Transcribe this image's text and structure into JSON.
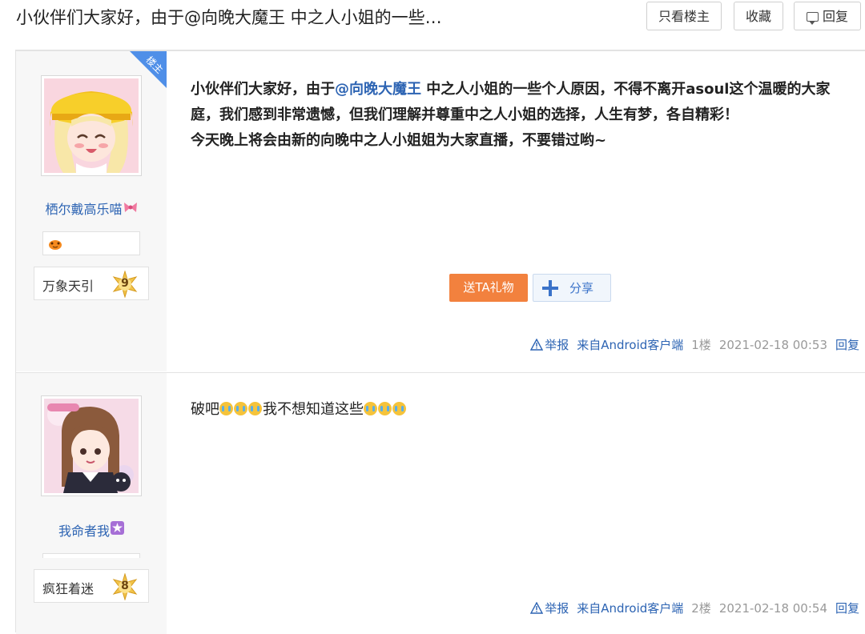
{
  "header": {
    "title": "小伙伴们大家好，由于@向晚大魔王 中之人小姐的一些…",
    "only_op_label": "只看楼主",
    "favorite_label": "收藏",
    "reply_label": "回复"
  },
  "posts": [
    {
      "is_op": true,
      "op_badge": "楼主",
      "username": "栖尔戴高乐喵",
      "level_name": "万象天引",
      "level": "9",
      "content_before": "小伙伴们大家好，由于",
      "mention": "@向晚大魔王",
      "content_after": " 中之人小姐的一些个人原因，不得不离开asoul这个温暖的大家庭，我们感到非常遗憾，但我们理解并尊重中之人小姐的选择，人生有梦，各自精彩！",
      "content_line2": "今天晚上将会由新的向晚中之人小姐姐为大家直播，不要错过哟~",
      "gift_label": "送TA礼物",
      "share_label": "分享",
      "report_label": "举报",
      "source": "来自Android客户端",
      "floor": "1楼",
      "time": "2021-02-18 00:53",
      "reply_label": "回复"
    },
    {
      "is_op": false,
      "username": "我命者我",
      "level_name": "疯狂着迷",
      "level": "8",
      "content_before": "破吧",
      "content_after": "我不想知道这些",
      "report_label": "举报",
      "source": "来自Android客户端",
      "floor": "2楼",
      "time": "2021-02-18 00:54",
      "reply_label": "回复"
    }
  ],
  "colors": {
    "link": "#2d64b3",
    "gift": "#f2813e",
    "op_badge": "#4f8fe8"
  },
  "icons": [
    "reply-icon",
    "warning-icon",
    "share-plus-icon",
    "level-star-icon",
    "crying-emoji-icon",
    "bow-icon",
    "cheer-icon"
  ]
}
